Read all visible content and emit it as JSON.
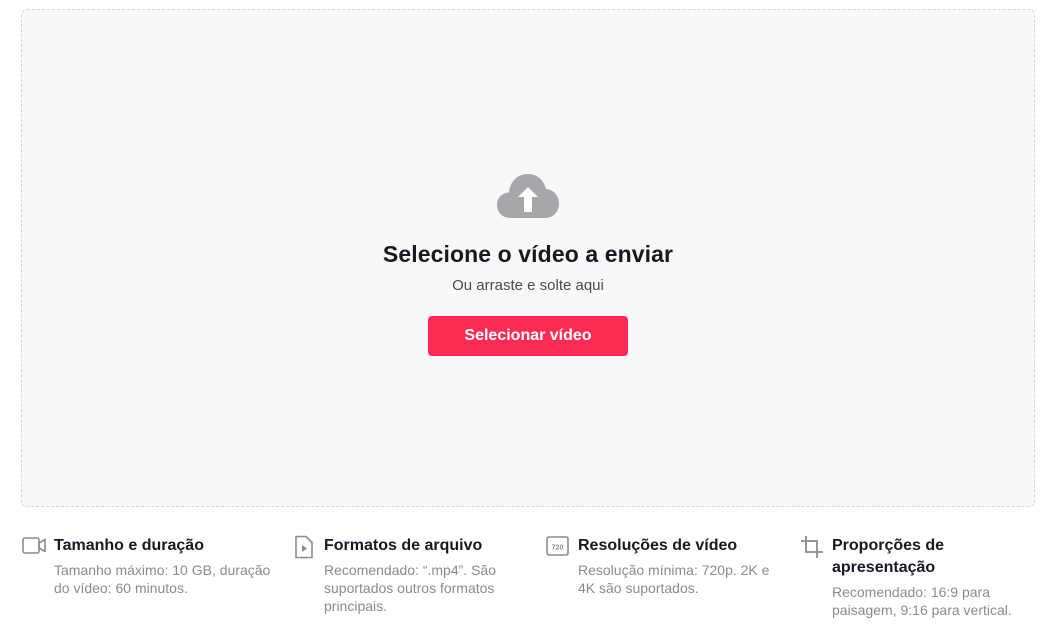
{
  "upload": {
    "icon": "cloud-upload-icon",
    "title": "Selecione o vídeo a enviar",
    "subtitle": "Ou arraste e solte aqui",
    "button_label": "Selecionar vídeo"
  },
  "info": [
    {
      "icon": "video-camera-icon",
      "title": "Tamanho e duração",
      "description": "Tamanho máximo: 10 GB, duração do vídeo: 60 minutos."
    },
    {
      "icon": "video-file-icon",
      "title": "Formatos de arquivo",
      "description": "Recomendado: “.mp4”. São suportados outros formatos principais."
    },
    {
      "icon": "resolution-720-icon",
      "icon_text": "720",
      "title": "Resoluções de vídeo",
      "description": "Resolução mínima: 720p. 2K e 4K são suportados."
    },
    {
      "icon": "crop-icon",
      "title": "Proporções de apresentação",
      "description": "Recomendado: 16:9 para paisagem, 9:16 para vertical."
    }
  ],
  "colors": {
    "accent": "#fe2c55",
    "dropzone_bg": "#f8f8f8",
    "icon_gray": "#a7a7ab",
    "text_primary": "#161823",
    "text_secondary": "#8a8b91"
  }
}
